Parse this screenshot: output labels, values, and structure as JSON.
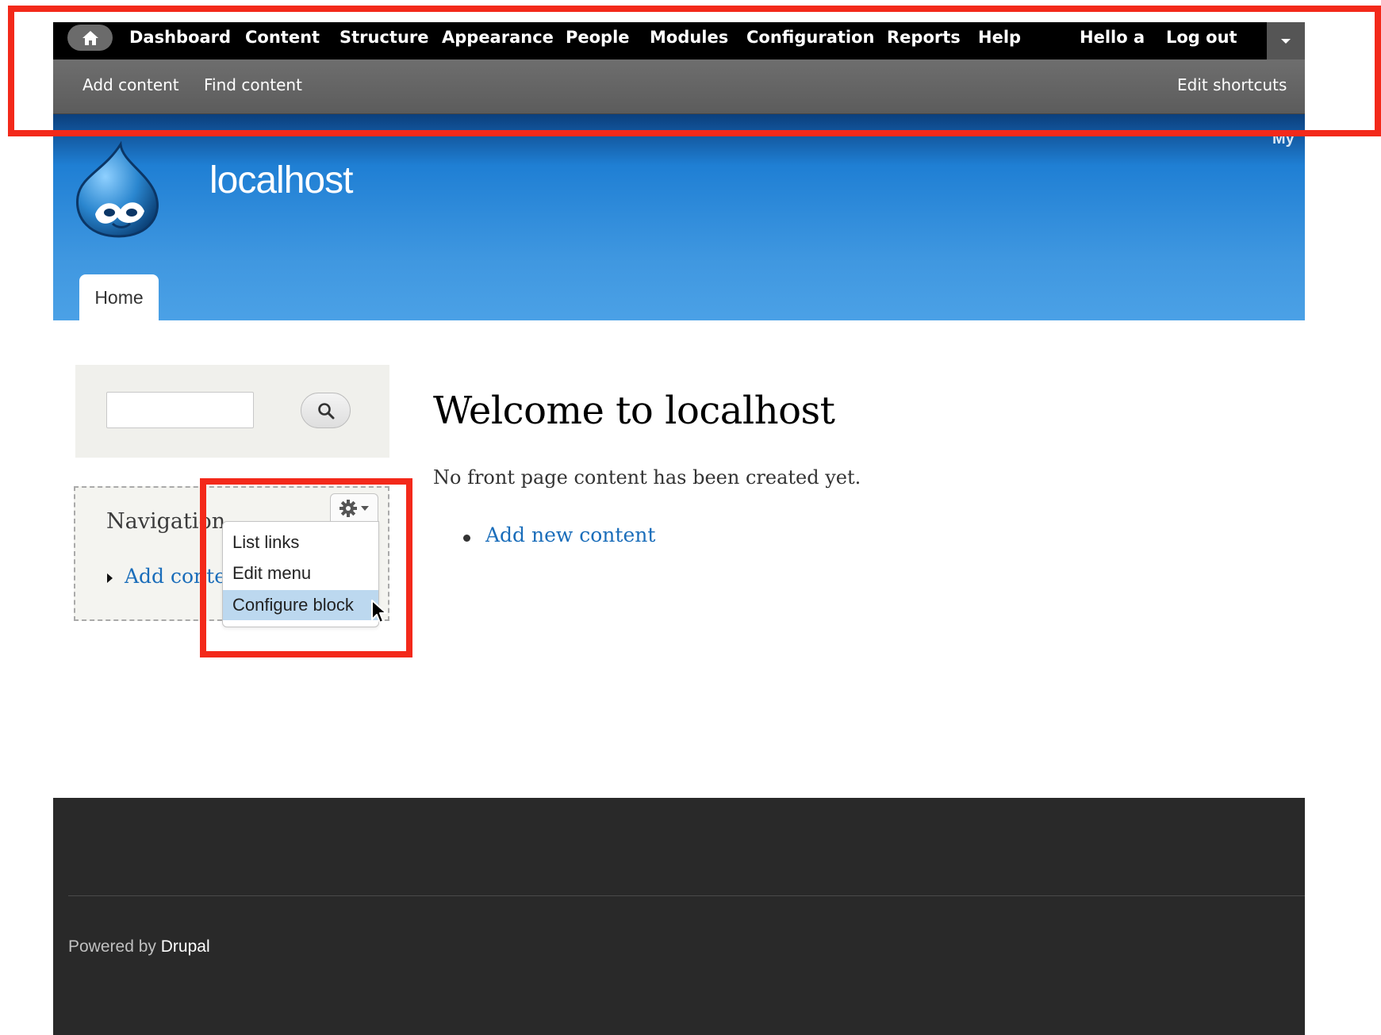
{
  "toolbar": {
    "home_icon": "home-icon",
    "items": [
      "Dashboard",
      "Content",
      "Structure",
      "Appearance",
      "People",
      "Modules",
      "Configuration",
      "Reports",
      "Help"
    ],
    "greeting": "Hello a",
    "logout": "Log out",
    "drawer_icon": "caret-down-icon"
  },
  "shortcuts": {
    "items": [
      "Add content",
      "Find content"
    ],
    "edit": "Edit shortcuts"
  },
  "header": {
    "site_name": "localhost",
    "secondary_menu_fragment": "My",
    "logo_icon": "drupal-drop-logo"
  },
  "tabs": {
    "home": "Home"
  },
  "search": {
    "value": "",
    "icon": "search-icon"
  },
  "navigation": {
    "title": "Navigation",
    "link": "Add content"
  },
  "contextual": {
    "icon": "gear-icon",
    "items": [
      "List links",
      "Edit menu",
      "Configure block"
    ],
    "highlighted": "Configure block"
  },
  "main": {
    "title": "Welcome to localhost",
    "message": "No front page content has been created yet.",
    "link": "Add new content"
  },
  "footer": {
    "powered_prefix": "Powered by",
    "powered_link": "Drupal"
  },
  "colors": {
    "annotation": "#f3291a",
    "link": "#1a6dba",
    "header_blue": "#3f97e0",
    "highlight": "#bcd8ef"
  }
}
